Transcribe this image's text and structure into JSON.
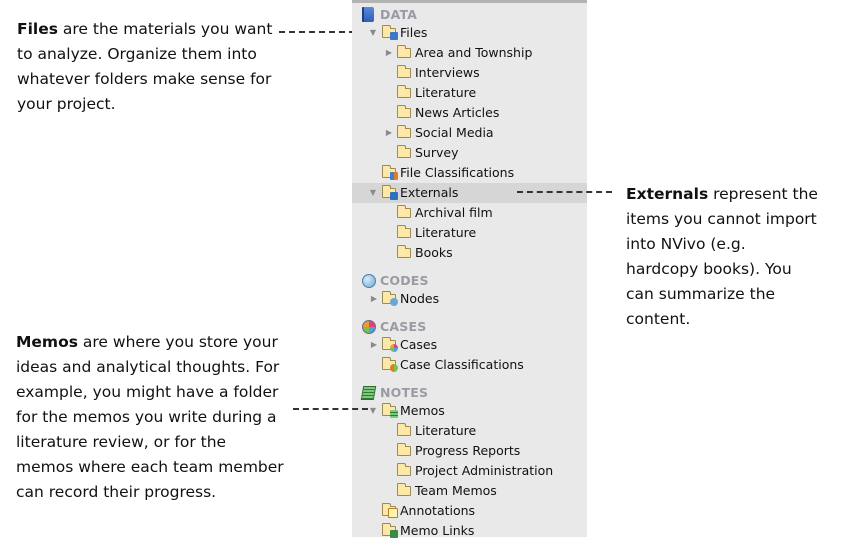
{
  "callouts": {
    "files": {
      "bold": "Files",
      "lines": [
        " are the materials you want",
        "to analyze. Organize them into",
        "whatever folders make sense for",
        "your project."
      ]
    },
    "externals": {
      "bold": "Externals",
      "lines": [
        " represent the",
        "items you cannot import",
        "into NVivo (e.g.",
        "hardcopy books). You",
        "can summarize the",
        "content."
      ]
    },
    "memos": {
      "bold": "Memos",
      "lines": [
        " are where you store your",
        "ideas and analytical thoughts. For",
        "example, you might have a folder",
        "for the memos you write during a",
        "literature review, or for the",
        "memos where each team member",
        "can record their progress."
      ]
    }
  },
  "tree": {
    "data_section": "DATA",
    "files": "Files",
    "files_children": [
      "Area and Township",
      "Interviews",
      "Literature",
      "News Articles",
      "Social Media",
      "Survey"
    ],
    "file_classifications": "File Classifications",
    "externals": "Externals",
    "externals_children": [
      "Archival film",
      "Literature",
      "Books"
    ],
    "codes_section": "CODES",
    "nodes": "Nodes",
    "cases_section": "CASES",
    "cases": "Cases",
    "case_classifications": "Case Classifications",
    "notes_section": "NOTES",
    "memos": "Memos",
    "memos_children": [
      "Literature",
      "Progress Reports",
      "Project Administration",
      "Team Memos"
    ],
    "annotations": "Annotations",
    "memo_links": "Memo Links"
  },
  "colors": {
    "panel_bg": "#e9e9e9",
    "selected_row": "#d6d6d6",
    "section_text": "#9a9aa5"
  }
}
